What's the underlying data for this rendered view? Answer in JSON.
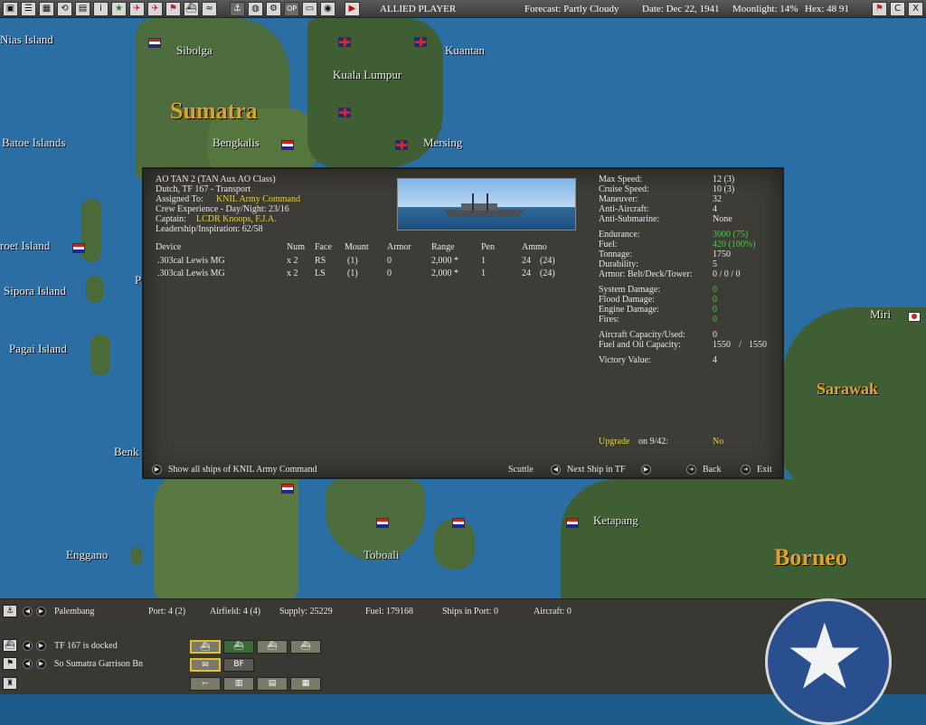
{
  "topbar": {
    "side": "ALLIED PLAYER",
    "forecast": "Forecast: Partly Cloudy",
    "date": "Date: Dec 22, 1941",
    "moonlight": "Moonlight: 14%",
    "hex": "Hex: 48 91",
    "btn_op": "OP",
    "btn_c": "C",
    "btn_x": "X"
  },
  "map": {
    "labels": {
      "nias": "Nias Island",
      "sibolga": "Sibolga",
      "sumatra": "Sumatra",
      "kuala_lumpur": "Kuala Lumpur",
      "kuantan": "Kuantan",
      "batoe": "Batoe Islands",
      "bengkalis": "Bengkalis",
      "mersing": "Mersing",
      "roet": "roet Island",
      "sipora": "Sipora Island",
      "pagai": "Pagai Island",
      "miri": "Miri",
      "sarawak": "Sarawak",
      "benk": "Benk",
      "p": "P",
      "enggano": "Enggano",
      "toboali": "Toboali",
      "ketapang": "Ketapang",
      "borneo": "Borneo"
    }
  },
  "ship": {
    "name": "AO TAN 2 (TAN Aux AO Class)",
    "tf": "Dutch, TF 167 - Transport",
    "assigned_label": "Assigned To:",
    "assigned_value": "KNIL Army Command",
    "crew": "Crew Experience - Day/Night: 23/16",
    "captain_label": "Captain:",
    "captain_value": "LCDR Knoops, F.J.A.",
    "leadership": "Leadership/Inspiration: 62/58"
  },
  "devices": {
    "headers": {
      "device": "Device",
      "num": "Num",
      "face": "Face",
      "mount": "Mount",
      "armor": "Armor",
      "range": "Range",
      "pen": "Pen",
      "ammo": "Ammo"
    },
    "rows": [
      {
        "device": ".303cal Lewis MG",
        "num": "x 2",
        "face": "RS",
        "mount": "(1)",
        "armor": "0",
        "range": "2,000 *",
        "pen": "1",
        "ammo": "24",
        "ammo_max": "(24)"
      },
      {
        "device": ".303cal Lewis MG",
        "num": "x 2",
        "face": "LS",
        "mount": "(1)",
        "armor": "0",
        "range": "2,000 *",
        "pen": "1",
        "ammo": "24",
        "ammo_max": "(24)"
      }
    ]
  },
  "stats": {
    "max_speed_l": "Max Speed:",
    "max_speed_v": "12 (3)",
    "cruise_l": "Cruise Speed:",
    "cruise_v": "10 (3)",
    "maneuver_l": "Maneuver:",
    "maneuver_v": "32",
    "aa_l": "Anti-Aircraft:",
    "aa_v": "4",
    "asw_l": "Anti-Submarine:",
    "asw_v": "None",
    "endurance_l": "Endurance:",
    "endurance_v": "3000 (75)",
    "fuel_l": "Fuel:",
    "fuel_v": "420 (100%)",
    "tonnage_l": "Tonnage:",
    "tonnage_v": "1750",
    "durability_l": "Durability:",
    "durability_v": "5",
    "armorbdt_l": "Armor: Belt/Deck/Tower:",
    "armorbdt_v": "0 / 0 / 0",
    "sysdmg_l": "System Damage:",
    "sysdmg_v": "0",
    "flooddmg_l": "Flood Damage:",
    "flooddmg_v": "0",
    "enginedmg_l": "Engine Damage:",
    "enginedmg_v": "0",
    "fires_l": "Fires:",
    "fires_v": "0",
    "aircraft_l": "Aircraft Capacity/Used:",
    "aircraft_v": "0",
    "fueloil_l": "Fuel and Oil Capacity:",
    "fueloil_v": "1550",
    "fueloil_sep": "/",
    "fueloil_v2": "1550",
    "victory_l": "Victory Value:",
    "victory_v": "4",
    "upgrade_l": "Upgrade",
    "upgrade_on": "on 9/42:",
    "upgrade_v": "No"
  },
  "dialog_buttons": {
    "show_all": "Show all ships of KNIL Army Command",
    "scuttle": "Scuttle",
    "next_ship": "Next Ship in TF",
    "back": "Back",
    "exit": "Exit"
  },
  "bottom": {
    "base": "Palembang",
    "port": "Port: 4 (2)",
    "airfield": "Airfield: 4 (4)",
    "supply": "Supply: 25229",
    "fuel": "Fuel: 179168",
    "ships_in_port": "Ships in Port: 0",
    "aircraft": "Aircraft: 0",
    "tf_status": "TF 167 is docked",
    "unit": "So Sumatra Garrison Bn",
    "bf_label": "BF"
  },
  "colors": {
    "accent_yellow": "#e8d040",
    "status_green": "#40d040",
    "dialog_bg": "#3e3c36"
  }
}
